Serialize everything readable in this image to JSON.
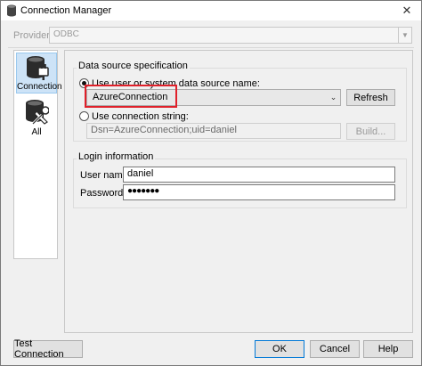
{
  "window": {
    "title": "Connection Manager",
    "close_glyph": "✕"
  },
  "provider": {
    "label": "Provider:",
    "value": "ODBC"
  },
  "nav": [
    {
      "label": "Connection",
      "icon": "database-plug-icon",
      "selected": true
    },
    {
      "label": "All",
      "icon": "tools-icon",
      "selected": false
    }
  ],
  "datasource": {
    "group_title": "Data source specification",
    "use_dsn_label": "Use user or system data source name:",
    "dsn_value": "AzureConnection",
    "refresh_label": "Refresh",
    "use_connstr_label": "Use connection string:",
    "connstr_value": "Dsn=AzureConnection;uid=daniel",
    "build_label": "Build..."
  },
  "login": {
    "group_title": "Login information",
    "username_label": "User name:",
    "username_value": "daniel",
    "password_label": "Password:",
    "password_value": "●●●●●●●"
  },
  "footer": {
    "test_label": "Test Connection",
    "ok_label": "OK",
    "cancel_label": "Cancel",
    "help_label": "Help"
  },
  "colors": {
    "highlight": "#e0202a",
    "selection": "#cde3f7",
    "accent": "#0078d7"
  }
}
